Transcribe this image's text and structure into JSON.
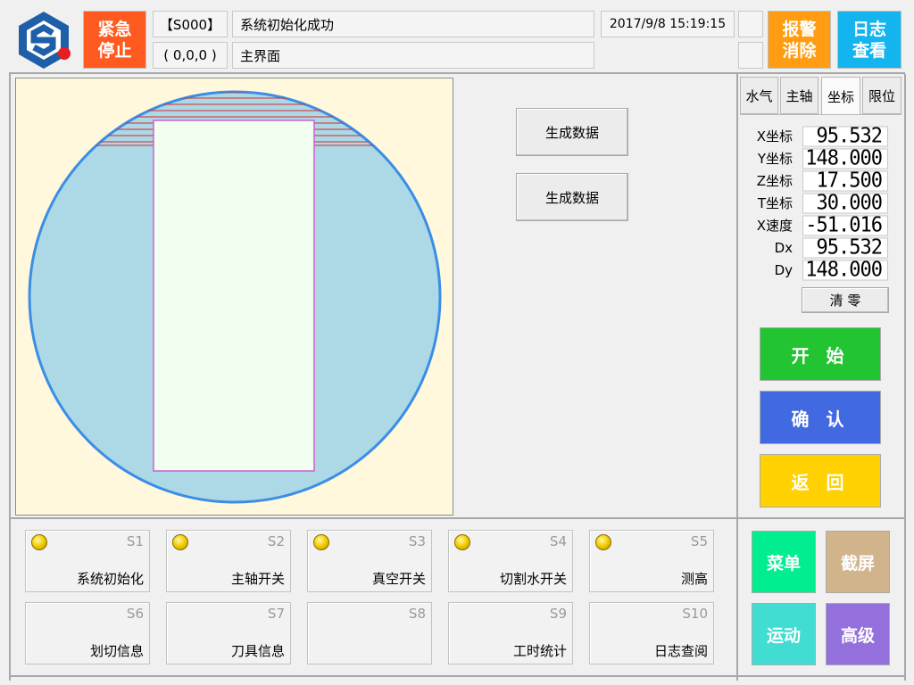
{
  "header": {
    "emergency_stop_label": "紧急\n停止",
    "status_code": "【S000】",
    "status_message": "系统初始化成功",
    "position_text": "( 0,0,0 )",
    "current_page": "主界面",
    "datetime": "2017/9/8 15:19:15",
    "alarm_clear_label": "报警\n消除",
    "log_view_label": "日志\n查看"
  },
  "canvas": {
    "generate_button_1": "生成数据",
    "generate_button_2": "生成数据"
  },
  "tabs": [
    {
      "label": "水气",
      "active": false
    },
    {
      "label": "主轴",
      "active": false
    },
    {
      "label": "坐标",
      "active": true
    },
    {
      "label": "限位",
      "active": false
    }
  ],
  "coords": [
    {
      "label": "X坐标",
      "value": "95.532"
    },
    {
      "label": "Y坐标",
      "value": "148.000"
    },
    {
      "label": "Z坐标",
      "value": "17.500"
    },
    {
      "label": "T坐标",
      "value": "30.000"
    },
    {
      "label": "X速度",
      "value": "-51.016"
    },
    {
      "label": "Dx",
      "value": "95.532"
    },
    {
      "label": "Dy",
      "value": "148.000"
    }
  ],
  "clear_zero_label": "清 零",
  "commands": {
    "start": "开 始",
    "confirm": "确 认",
    "back": "返 回"
  },
  "status_cells": [
    {
      "code": "S1",
      "label": "系统初始化",
      "led": true
    },
    {
      "code": "S2",
      "label": "主轴开关",
      "led": true
    },
    {
      "code": "S3",
      "label": "真空开关",
      "led": true
    },
    {
      "code": "S4",
      "label": "切割水开关",
      "led": true
    },
    {
      "code": "S5",
      "label": "测高",
      "led": true
    },
    {
      "code": "S6",
      "label": "划切信息",
      "led": false
    },
    {
      "code": "S7",
      "label": "刀具信息",
      "led": false
    },
    {
      "code": "S8",
      "label": "",
      "led": false
    },
    {
      "code": "S9",
      "label": "工时统计",
      "led": false
    },
    {
      "code": "S10",
      "label": "日志查阅",
      "led": false
    }
  ],
  "nav": {
    "menu": "菜单",
    "screenshot": "截屏",
    "motion": "运动",
    "advanced": "高级"
  },
  "colors": {
    "emergency": "#ff5a1f",
    "alarm": "#ff9c12",
    "log": "#14b4ee",
    "start": "#22c431",
    "confirm": "#4169e1",
    "back": "#ffd100",
    "menu": "#00ee90",
    "screenshot": "#d2b48c",
    "motion": "#42ddd2",
    "advanced": "#9370db",
    "wafer": "#add8e6",
    "canvas_bg": "#fff8dc"
  }
}
